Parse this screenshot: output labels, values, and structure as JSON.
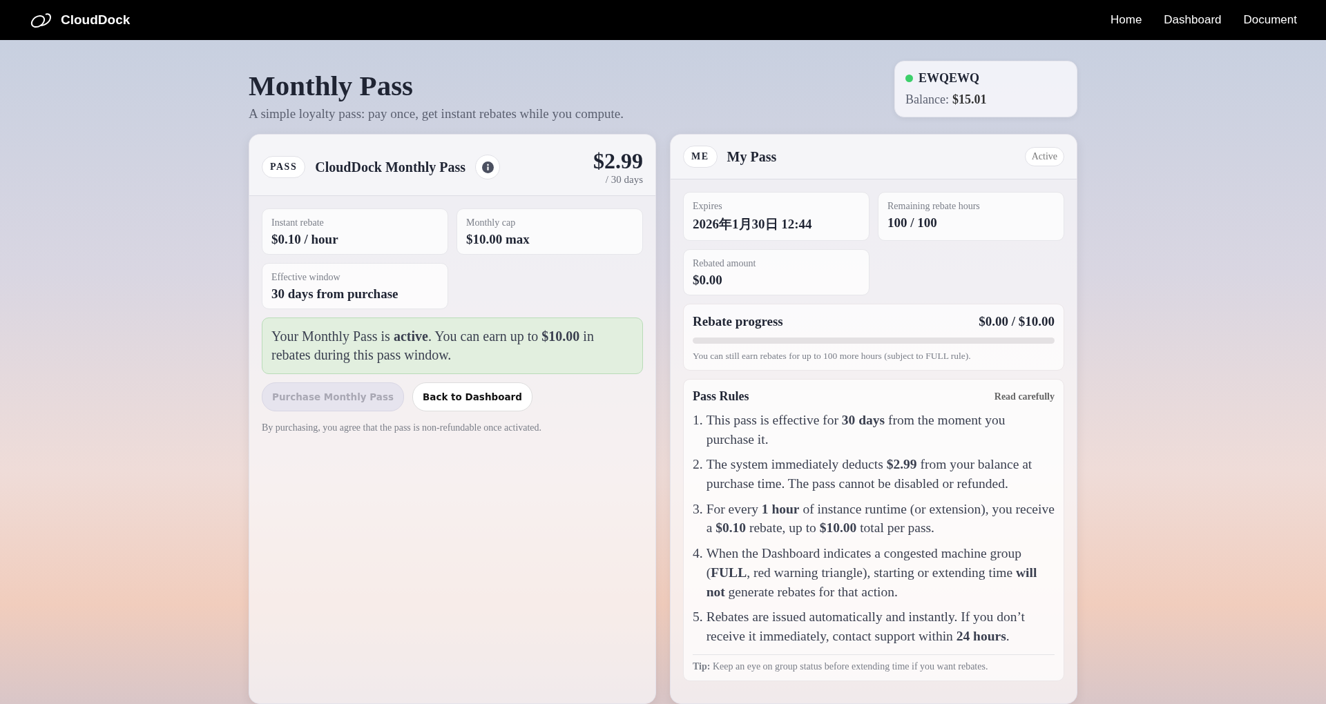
{
  "navbar": {
    "brand": "CloudDock",
    "links": [
      "Home",
      "Dashboard",
      "Document"
    ]
  },
  "page": {
    "title": "Monthly Pass",
    "subtitle": "A simple loyalty pass: pay once, get instant rebates while you compute."
  },
  "account": {
    "name": "EWQEWQ",
    "online": true,
    "balance_label": "Balance:",
    "balance": "$15.01"
  },
  "pass_card": {
    "tag": "PASS",
    "title": "CloudDock Monthly Pass",
    "price": "$2.99",
    "period": "/ 30 days",
    "stats": [
      {
        "label": "Instant rebate",
        "value": "$0.10 / hour"
      },
      {
        "label": "Monthly cap",
        "value": "$10.00 max"
      },
      {
        "label": "Effective window",
        "value": "30 days from purchase"
      }
    ],
    "notice": "Your Monthly Pass is **active**. You can earn up to **$10.00** in rebates during this pass window.",
    "buttons": [
      {
        "label": "Purchase Monthly Pass",
        "kind": "primary",
        "disabled": true
      },
      {
        "label": "Back to Dashboard",
        "kind": "secondary",
        "disabled": false
      }
    ],
    "disclaimer": "By purchasing, you agree that the pass is non-refundable once activated."
  },
  "my_pass": {
    "tag": "ME",
    "title": "My Pass",
    "status": "Active",
    "stats": [
      {
        "label": "Expires",
        "value": "2026年1月30日 12:44"
      },
      {
        "label": "Remaining rebate hours",
        "value": "100 / 100"
      },
      {
        "label": "Rebated amount",
        "value": "$0.00"
      }
    ],
    "progress": {
      "title": "Rebate progress",
      "reading": "$0.00 / $10.00",
      "level": 0,
      "note": "You can still earn rebates for up to 100 more hours (subject to FULL rule)."
    },
    "rules": {
      "title": "Pass Rules",
      "hint": "Read carefully",
      "items": [
        {
          "number": "1.",
          "text": "This pass is effective for **30 days** from the moment you purchase it."
        },
        {
          "number": "2.",
          "text": "The system immediately deducts **$2.99** from your balance at purchase time. The pass cannot be disabled or refunded."
        },
        {
          "number": "3.",
          "text": "For every **1 hour** of instance runtime (or extension), you receive a **$0.10** rebate, up to **$10.00** total per pass."
        },
        {
          "number": "4.",
          "text": "When the Dashboard indicates a congested machine group (**FULL**, red warning triangle), starting or extending time **will not** generate rebates for that action."
        },
        {
          "number": "5.",
          "text": "Rebates are issued automatically and instantly. If you don’t receive it immediately, contact support within **24 hours**."
        }
      ],
      "tip": "**Tip:** Keep an eye on group status before extending time if you want rebates."
    }
  }
}
